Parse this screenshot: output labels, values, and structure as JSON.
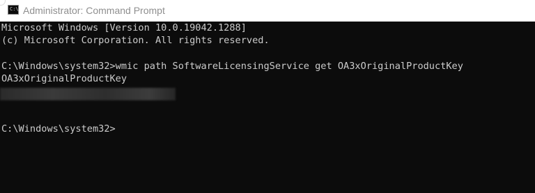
{
  "window": {
    "title": "Administrator: Command Prompt",
    "icon": "cmd-icon",
    "icon_glyph": "C:\\"
  },
  "console": {
    "lines": [
      "Microsoft Windows [Version 10.0.19042.1288]",
      "(c) Microsoft Corporation. All rights reserved.",
      "C:\\Windows\\system32>wmic path SoftwareLicensingService get OA3xOriginalProductKey",
      "OA3xOriginalProductKey",
      "C:\\Windows\\system32>"
    ],
    "redacted_line": "blurred-product-key"
  }
}
